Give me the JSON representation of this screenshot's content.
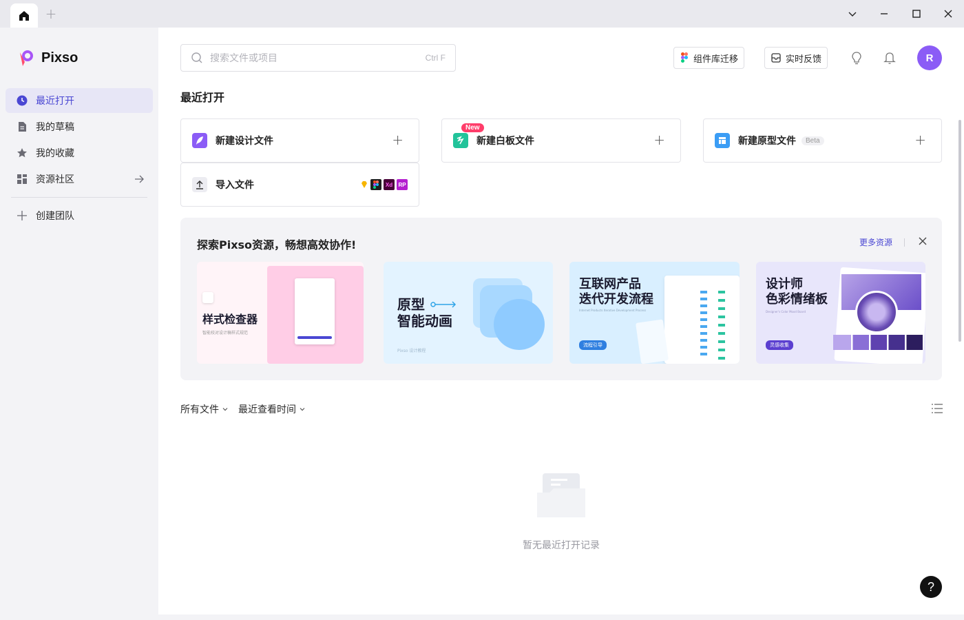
{
  "app": {
    "name": "Pixso"
  },
  "window": {
    "add_tab": "+",
    "minimize_icon": "minimize-icon",
    "maximize_icon": "maximize-icon",
    "close_icon": "close-icon"
  },
  "sidebar": {
    "items": [
      {
        "label": "最近打开",
        "icon": "clock-icon",
        "active": true
      },
      {
        "label": "我的草稿",
        "icon": "draft-icon"
      },
      {
        "label": "我的收藏",
        "icon": "star-icon"
      },
      {
        "label": "资源社区",
        "icon": "grid-icon"
      }
    ],
    "create_team": "创建团队"
  },
  "header": {
    "search_placeholder": "搜索文件或项目",
    "search_shortcut": "Ctrl F",
    "migrate_label": "组件库迁移",
    "feedback_label": "实时反馈",
    "avatar_letter": "R"
  },
  "recent": {
    "title": "最近打开",
    "cards": {
      "design": "新建设计文件",
      "whiteboard": "新建白板文件",
      "whiteboard_badge": "New",
      "prototype": "新建原型文件",
      "prototype_badge": "Beta",
      "import": "导入文件",
      "import_formats": [
        "Xd",
        "RP"
      ]
    }
  },
  "explore": {
    "title": "探索Pixso资源，畅想高效协作!",
    "more": "更多资源",
    "resources": [
      {
        "title": "样式检查器",
        "subtitle": "智能校对设计稿样式规范"
      },
      {
        "title_line1": "原型",
        "title_line2": "智能动画",
        "footer": "Pixso 设计教程"
      },
      {
        "title_line1": "互联网产品",
        "title_line2": "迭代开发流程",
        "subtitle": "Internet Products Iterative Development Process",
        "tag": "流程引导"
      },
      {
        "title_line1": "设计师",
        "title_line2": "色彩情绪板",
        "subtitle": "Designer's Color Mood Board",
        "tag": "灵感收集"
      }
    ]
  },
  "files": {
    "filter_all": "所有文件",
    "filter_sort": "最近查看时间",
    "empty_text": "暂无最近打开记录",
    "help": "?"
  },
  "colors": {
    "accent": "#4a47d3",
    "avatar": "#8b5cf6",
    "new_badge": "#ff3d6a"
  }
}
